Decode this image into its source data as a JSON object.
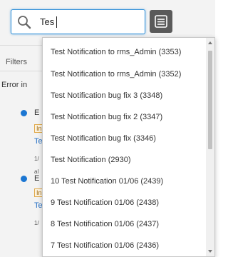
{
  "search": {
    "value": "Tes",
    "icon": "search-icon"
  },
  "toolbar": {
    "list_icon": "list-view-icon"
  },
  "filters": {
    "label": "Filters"
  },
  "section": {
    "label": "Error in"
  },
  "cards": [
    {
      "letter": "E",
      "tag": "In",
      "link": "Te",
      "meta": "1/",
      "extra": "al"
    },
    {
      "letter": "E",
      "tag": "In",
      "link": "Te",
      "meta": "1/",
      "extra": ""
    }
  ],
  "suggestions": [
    "Test Notification to rms_Admin (3353)",
    "Test Notification to rms_Admin (3352)",
    "Test Notification bug fix 3 (3348)",
    "Test Notification bug fix 2 (3347)",
    "Test Notification bug fix (3346)",
    "Test Notification (2930)",
    "10 Test Notification 01/06 (2439)",
    "9 Test Notification 01/06 (2438)",
    "8 Test Notification 01/06 (2437)",
    "7 Test Notification 01/06 (2436)"
  ],
  "colors": {
    "accent": "#2f8fd8",
    "status_dot": "#1b76d2",
    "link": "#2a73c6"
  }
}
